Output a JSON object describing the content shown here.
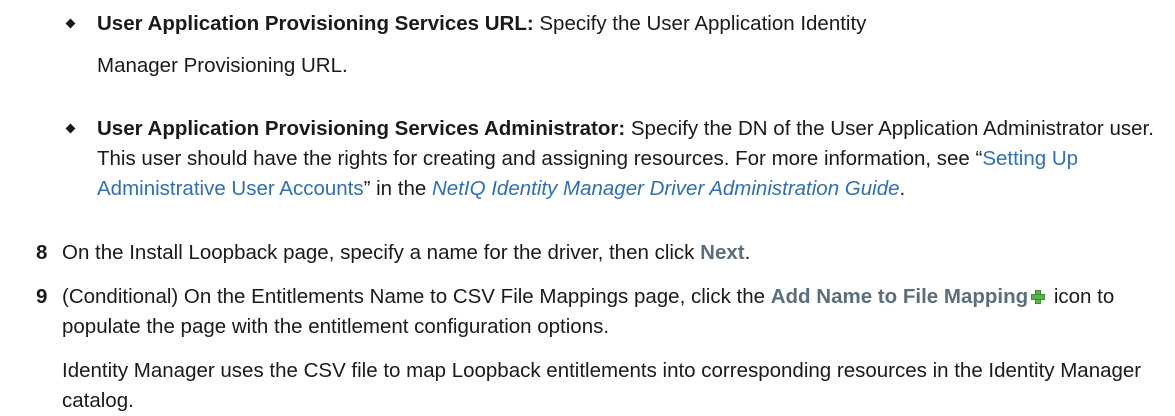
{
  "bullets": [
    {
      "term": "User Application Provisioning Services URL:",
      "text_before": " Specify the User Application Identity",
      "text_line2": "Manager Provisioning URL."
    },
    {
      "term": "User Application Provisioning Services Administrator:",
      "text": " Specify the DN of the User Application Administrator user. This user should have the rights for creating and assigning resources. For more information, see “",
      "link": "Setting Up Administrative User Accounts",
      "text_mid": "” in the ",
      "guide_link": "NetIQ Identity Manager Driver Administration Guide",
      "text_end": "."
    }
  ],
  "steps": [
    {
      "number": "8",
      "text_before": "On the Install Loopback page, specify a name for the driver, then click ",
      "ui_label": "Next",
      "text_after": "."
    },
    {
      "number": "9",
      "text_before": "(Conditional) On the Entitlements Name to CSV File Mappings page, click the ",
      "ui_label": "Add Name to File Mapping",
      "icon": "add-icon",
      "text_after": " icon to populate the page with the entitlement configuration options."
    }
  ],
  "paragraph": "Identity Manager uses the CSV file to map Loopback entitlements into corresponding resources in the Identity Manager catalog."
}
